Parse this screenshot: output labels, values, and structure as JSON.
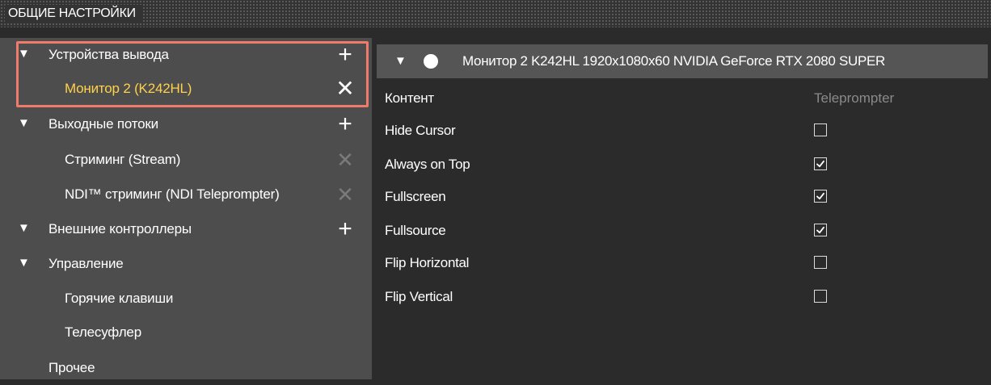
{
  "header": {
    "title": "ОБЩИЕ НАСТРОЙКИ"
  },
  "tree": {
    "output_devices": {
      "label": "Устройства вывода",
      "add": "+"
    },
    "monitor": {
      "label": "Монитор 2 (K242HL)",
      "remove": "✕"
    },
    "output_streams": {
      "label": "Выходные потоки",
      "add": "+"
    },
    "stream": {
      "label": "Стриминг (Stream)",
      "remove": "✕"
    },
    "ndi_stream": {
      "label": "NDI™ стриминг (NDI Teleprompter)",
      "remove": "✕"
    },
    "external_controllers": {
      "label": "Внешние контроллеры",
      "add": "+"
    },
    "control": {
      "label": "Управление"
    },
    "hotkeys": {
      "label": "Горячие клавиши"
    },
    "teleprompter": {
      "label": "Телесуфлер"
    },
    "other": {
      "label": "Прочее"
    },
    "expand_arrow": "▼"
  },
  "details": {
    "title": "Монитор 2  K242HL 1920x1080x60  NVIDIA GeForce RTX 2080 SUPER",
    "toggle_on": true,
    "content_label": "Контент",
    "content_value": "Teleprompter",
    "options": [
      {
        "label": "Hide Cursor",
        "checked": false
      },
      {
        "label": "Always on Top",
        "checked": true
      },
      {
        "label": "Fullscreen",
        "checked": true
      },
      {
        "label": "Fullsource",
        "checked": true
      },
      {
        "label": "Flip Horizontal",
        "checked": false
      },
      {
        "label": "Flip Vertical",
        "checked": false
      }
    ]
  },
  "colors": {
    "selected_text": "#ffd24a",
    "highlight_border": "#f07b6b",
    "left_panel": "#4d4d4d",
    "right_panel": "#2b2b2b"
  }
}
